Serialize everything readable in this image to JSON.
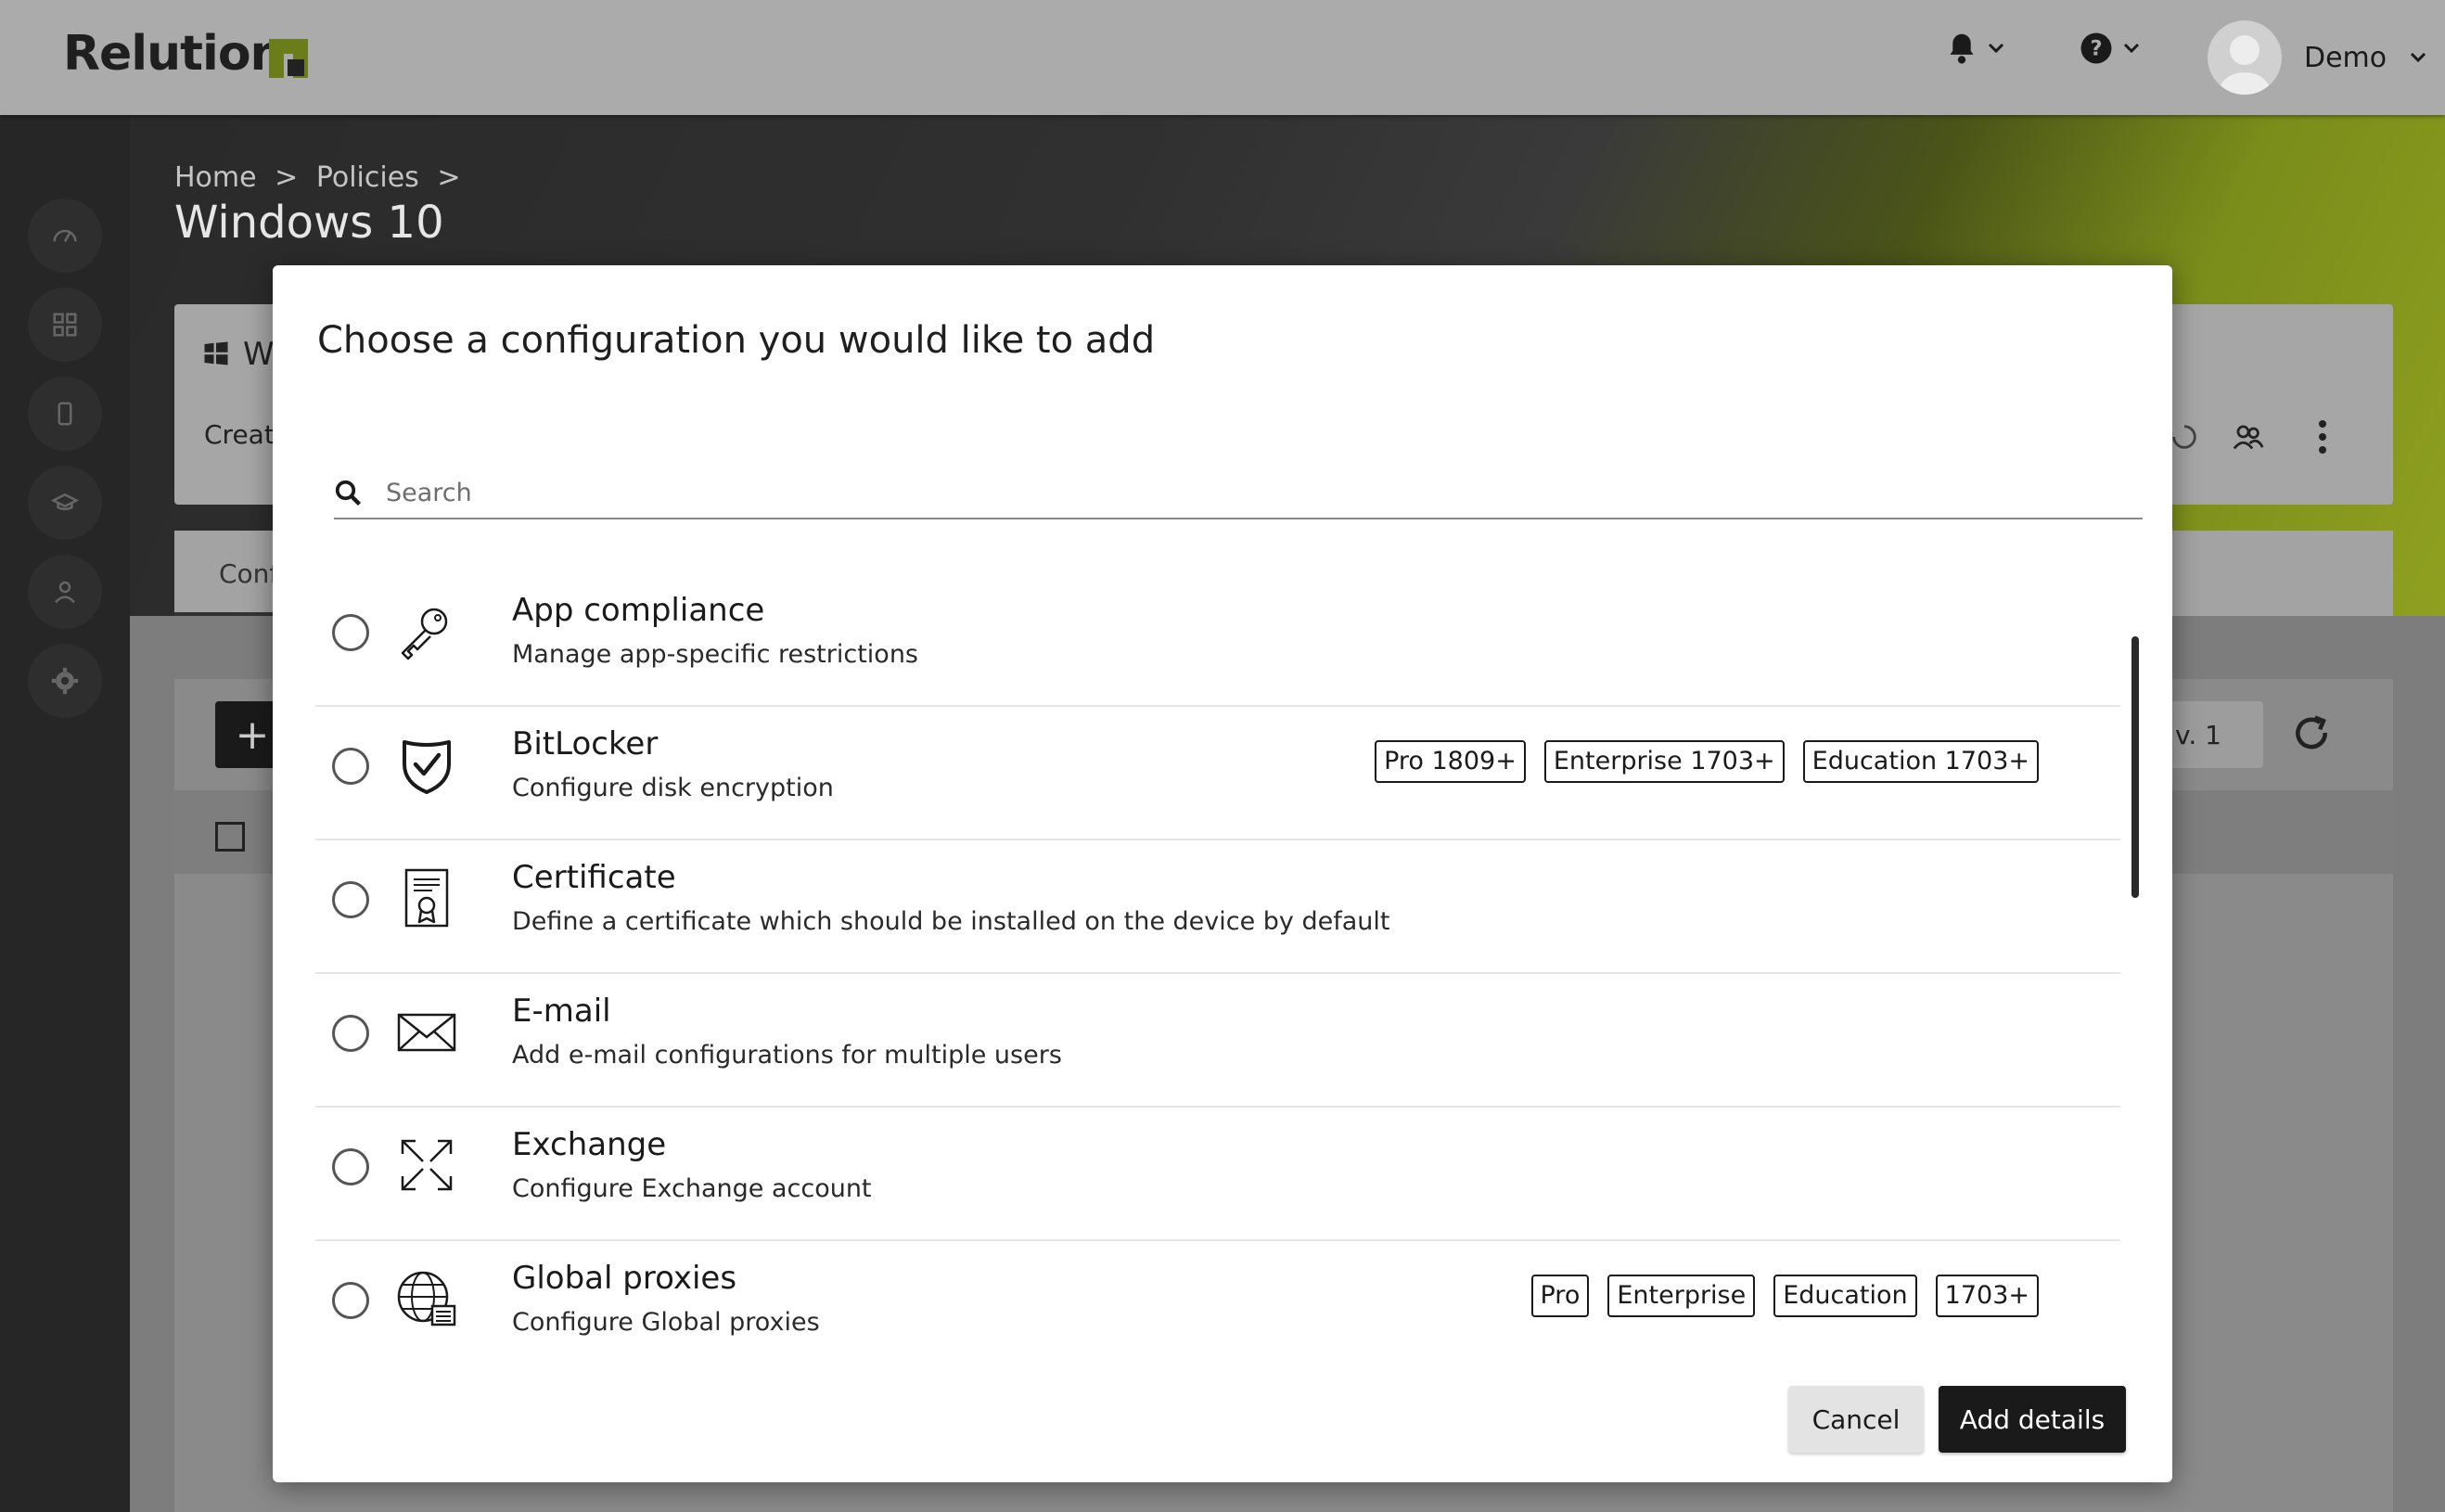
{
  "app": {
    "logo_text": "Relution"
  },
  "topbar": {
    "user_name": "Demo"
  },
  "breadcrumb": {
    "home": "Home",
    "sep": ">",
    "policies": "Policies"
  },
  "page": {
    "title": "Windows 10",
    "card_title_partial": "W",
    "card_subtitle_partial": "Create",
    "tab_partial": "Conf",
    "version_partial": "v. 1",
    "add_symbol": "+"
  },
  "modal": {
    "title": "Choose a configuration you would like to add",
    "search_placeholder": "Search",
    "items": [
      {
        "title": "App compliance",
        "desc": "Manage app-specific restrictions",
        "icon": "key-icon",
        "badges": []
      },
      {
        "title": "BitLocker",
        "desc": "Configure disk encryption",
        "icon": "shield-check-icon",
        "badges": [
          "Pro 1809+",
          "Enterprise 1703+",
          "Education 1703+"
        ]
      },
      {
        "title": "Certificate",
        "desc": "Define a certificate which should be installed on the device by default",
        "icon": "certificate-icon",
        "badges": []
      },
      {
        "title": "E-mail",
        "desc": "Add e-mail configurations for multiple users",
        "icon": "envelope-icon",
        "badges": []
      },
      {
        "title": "Exchange",
        "desc": "Configure Exchange account",
        "icon": "exchange-icon",
        "badges": []
      },
      {
        "title": "Global proxies",
        "desc": "Configure Global proxies",
        "icon": "globe-icon",
        "badges": [
          "Pro",
          "Enterprise",
          "Education",
          "1703+"
        ]
      }
    ],
    "cancel_label": "Cancel",
    "add_label": "Add details"
  },
  "colors": {
    "accent": "#8fa020",
    "primary_button": "#1a1a1a",
    "overlay": "#7a7a7a"
  }
}
